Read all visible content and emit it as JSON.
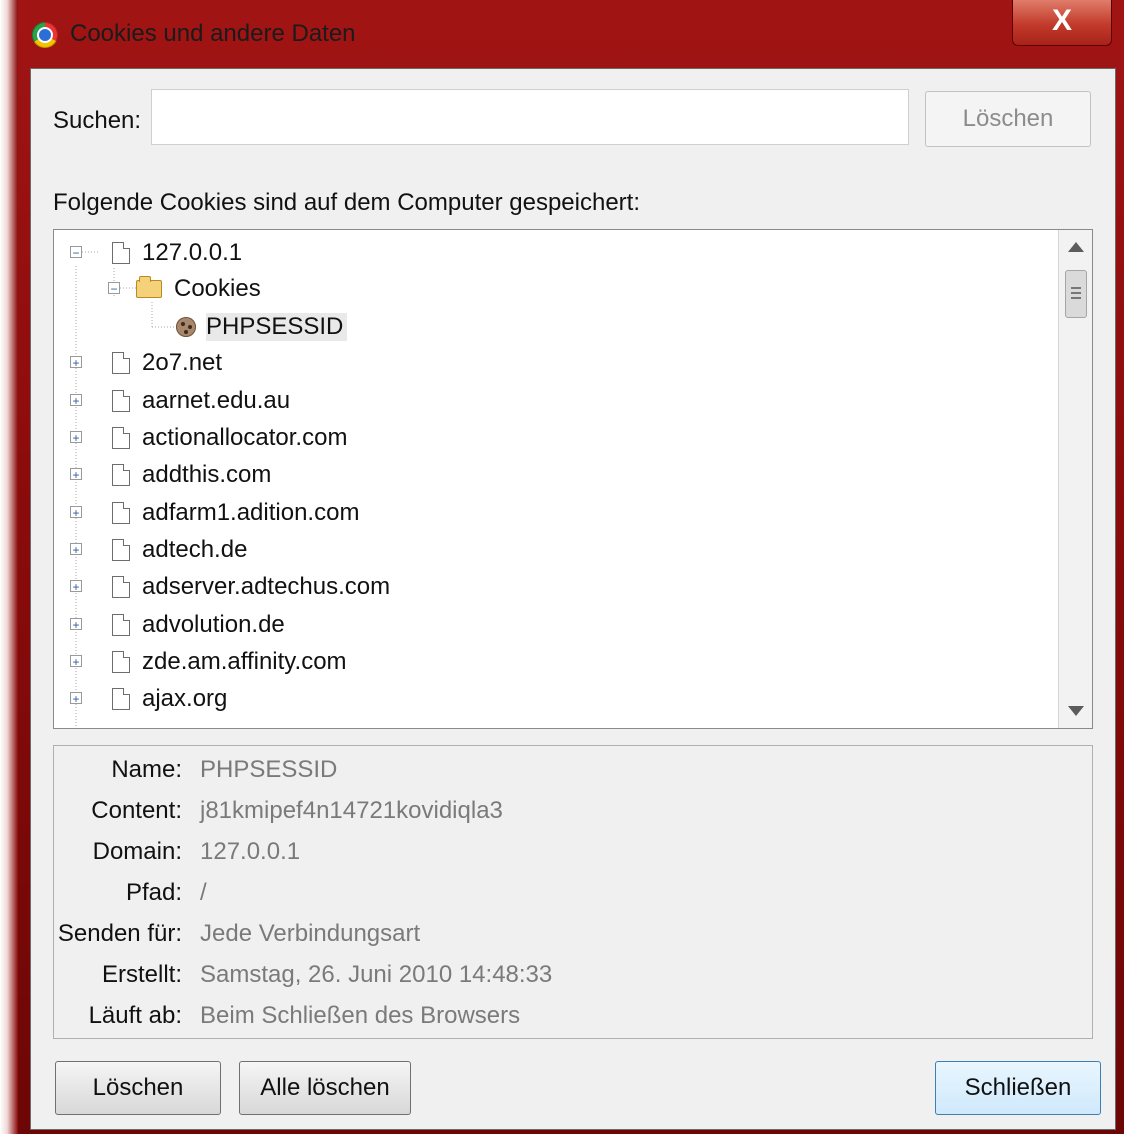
{
  "window": {
    "title": "Cookies und andere Daten",
    "close_label": "X"
  },
  "search": {
    "label": "Suchen:",
    "value": "",
    "placeholder": "",
    "clear_button": "Löschen"
  },
  "cookies_section": {
    "label": "Folgende Cookies sind auf dem Computer gespeichert:"
  },
  "tree": {
    "items": [
      {
        "label": "127.0.0.1",
        "expanded": true
      },
      {
        "label": "Cookies",
        "type": "folder",
        "expanded": true
      },
      {
        "label": "PHPSESSID",
        "type": "cookie",
        "selected": true
      },
      {
        "label": "2o7.net"
      },
      {
        "label": "aarnet.edu.au"
      },
      {
        "label": "actionallocator.com"
      },
      {
        "label": "addthis.com"
      },
      {
        "label": "adfarm1.adition.com"
      },
      {
        "label": "adtech.de"
      },
      {
        "label": "adserver.adtechus.com"
      },
      {
        "label": "advolution.de"
      },
      {
        "label": "zde.am.affinity.com"
      },
      {
        "label": "ajax.org"
      }
    ]
  },
  "details": {
    "name_label": "Name:",
    "name_value": "PHPSESSID",
    "content_label": "Content:",
    "content_value": "j81kmipef4n14721kovidiqla3",
    "domain_label": "Domain:",
    "domain_value": "127.0.0.1",
    "path_label": "Pfad:",
    "path_value": "/",
    "send_label": "Senden für:",
    "send_value": "Jede Verbindungsart",
    "created_label": "Erstellt:",
    "created_value": "Samstag, 26. Juni 2010 14:48:33",
    "expires_label": "Läuft ab:",
    "expires_value": "Beim Schließen des Browsers"
  },
  "buttons": {
    "delete": "Löschen",
    "delete_all": "Alle löschen",
    "close": "Schließen"
  },
  "colors": {
    "frame": "#8a0b0b",
    "client_bg": "#f0f0f0",
    "value_gray": "#7a7a7a",
    "default_button": "#cfe9fb"
  },
  "icons": {
    "app": "chrome-icon",
    "page": "page-icon",
    "folder": "folder-icon",
    "cookie": "cookie-icon"
  }
}
